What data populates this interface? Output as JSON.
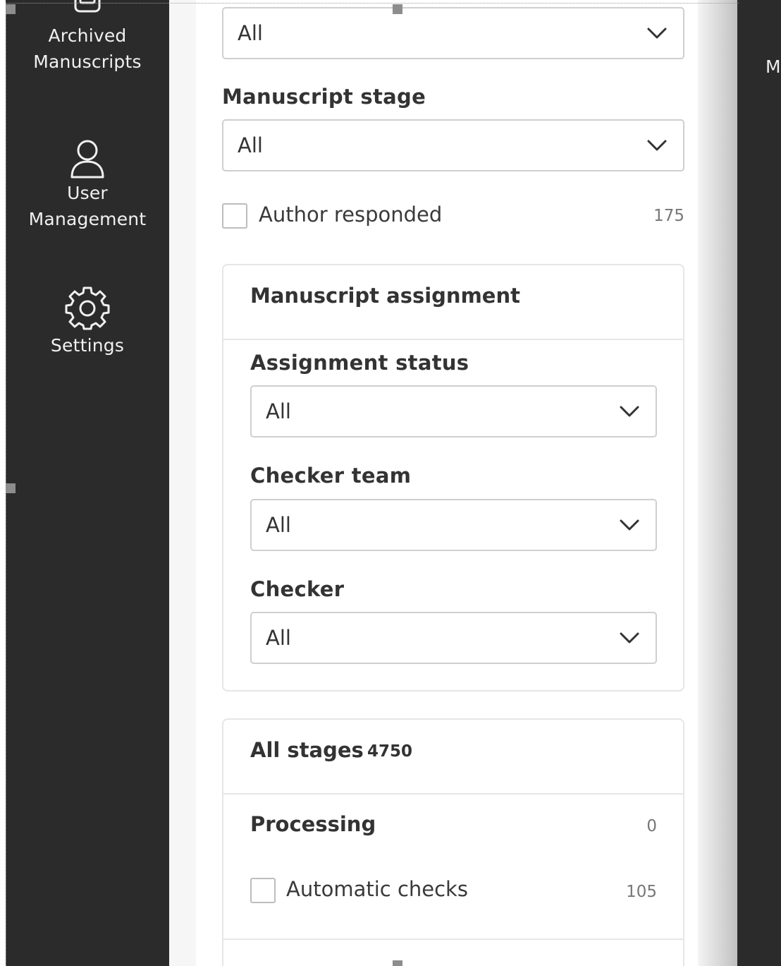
{
  "sidebar": {
    "items": [
      {
        "label": "Archived\nManuscripts",
        "icon": "archive-icon"
      },
      {
        "label": "User\nManagement",
        "icon": "user-icon"
      },
      {
        "label": "Settings",
        "icon": "gear-icon"
      }
    ]
  },
  "filters": {
    "top_select_value": "All",
    "manuscript_stage": {
      "label": "Manuscript stage",
      "value": "All"
    },
    "author_responded": {
      "label": "Author responded",
      "count": "175",
      "checked": false
    }
  },
  "assignment": {
    "title": "Manuscript assignment",
    "assignment_status": {
      "label": "Assignment status",
      "value": "All"
    },
    "checker_team": {
      "label": "Checker team",
      "value": "All"
    },
    "checker": {
      "label": "Checker",
      "value": "All"
    }
  },
  "stages": {
    "title": "All stages",
    "total": "4750",
    "processing": {
      "label": "Processing",
      "count": "0"
    },
    "automatic_checks": {
      "label": "Automatic checks",
      "count": "105",
      "checked": false
    }
  },
  "right_edge_letter": "M",
  "colors": {
    "sidebar_bg": "#2b2b2b",
    "panel_bg": "#ffffff",
    "border": "#cfcfcf",
    "text": "#333333"
  }
}
